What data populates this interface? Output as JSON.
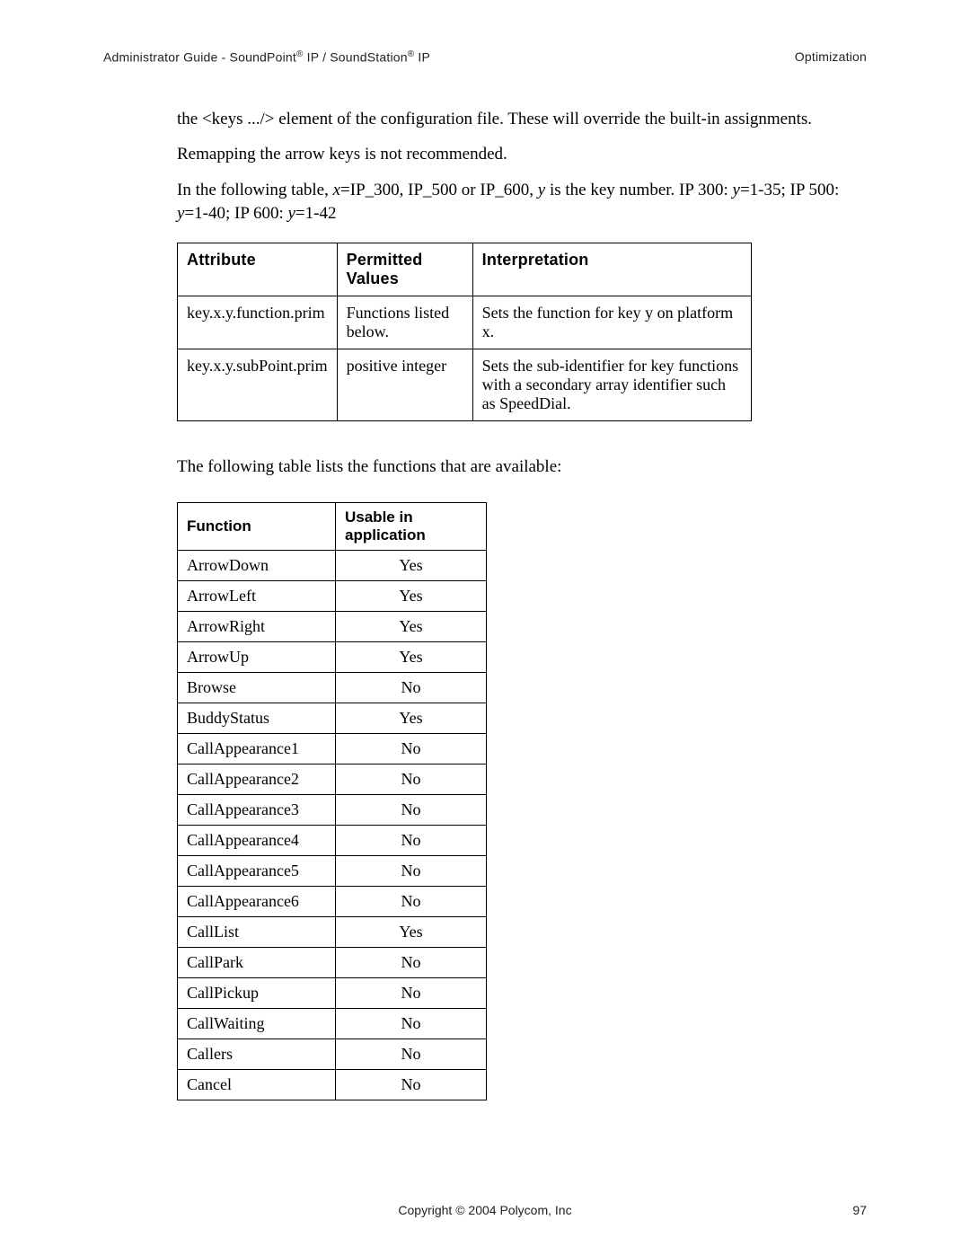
{
  "header": {
    "left_prefix": "Administrator Guide - SoundPoint",
    "left_mid": " IP / SoundStation",
    "left_suffix": " IP",
    "right": "Optimization"
  },
  "paras": {
    "p1a": "the <keys .../> element of the configuration file.  These will override the built-in assignments.",
    "p2": "Remapping the arrow keys is not recommended.",
    "p3_pre": "In the following table, ",
    "p3_x": "x",
    "p3_mid1": "=IP_300, IP_500 or IP_600, ",
    "p3_y": "y",
    "p3_mid2": " is the key number.  IP 300: ",
    "p3_y2": "y",
    "p3_mid3": "=1-35; IP 500: ",
    "p3_y3": "y",
    "p3_mid4": "=1-40; IP 600: ",
    "p3_y4": "y",
    "p3_end": "=1-42"
  },
  "attr_table": {
    "headers": {
      "c1": "Attribute",
      "c2": "Permitted Values",
      "c3": "Interpretation"
    },
    "rows": [
      {
        "attr": "key.x.y.function.prim",
        "values": "Functions listed below.",
        "interp": "Sets the function for key y on platform x."
      },
      {
        "attr": "key.x.y.subPoint.prim",
        "values": "positive integer",
        "interp": "Sets the sub-identifier for key functions with a secondary array identifier such as SpeedDial."
      }
    ]
  },
  "mid": "The following table lists the functions that are available:",
  "func_table": {
    "headers": {
      "c1": "Function",
      "c2": "Usable in application"
    },
    "rows": [
      {
        "name": "ArrowDown",
        "use": "Yes"
      },
      {
        "name": "ArrowLeft",
        "use": "Yes"
      },
      {
        "name": "ArrowRight",
        "use": "Yes"
      },
      {
        "name": "ArrowUp",
        "use": "Yes"
      },
      {
        "name": "Browse",
        "use": "No"
      },
      {
        "name": "BuddyStatus",
        "use": "Yes"
      },
      {
        "name": "CallAppearance1",
        "use": "No"
      },
      {
        "name": "CallAppearance2",
        "use": "No"
      },
      {
        "name": "CallAppearance3",
        "use": "No"
      },
      {
        "name": "CallAppearance4",
        "use": "No"
      },
      {
        "name": "CallAppearance5",
        "use": "No"
      },
      {
        "name": "CallAppearance6",
        "use": "No"
      },
      {
        "name": "CallList",
        "use": "Yes"
      },
      {
        "name": "CallPark",
        "use": "No"
      },
      {
        "name": "CallPickup",
        "use": "No"
      },
      {
        "name": "CallWaiting",
        "use": "No"
      },
      {
        "name": "Callers",
        "use": "No"
      },
      {
        "name": "Cancel",
        "use": "No"
      }
    ]
  },
  "footer": {
    "copyright": "Copyright © 2004 Polycom, Inc",
    "page": "97"
  }
}
